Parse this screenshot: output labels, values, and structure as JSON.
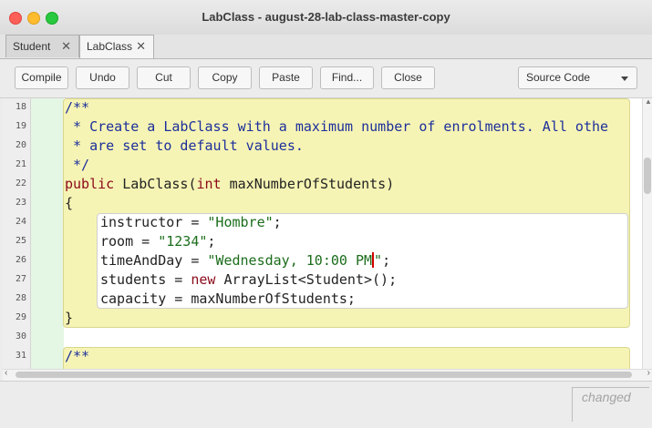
{
  "window": {
    "title": "LabClass - august-28-lab-class-master-copy"
  },
  "tabs": [
    {
      "label": "Student",
      "close": "✕"
    },
    {
      "label": "LabClass",
      "close": "✕"
    }
  ],
  "toolbar": {
    "compile": "Compile",
    "undo": "Undo",
    "cut": "Cut",
    "copy": "Copy",
    "paste": "Paste",
    "find": "Find...",
    "close": "Close",
    "view_select": "Source Code"
  },
  "editor": {
    "line_numbers": [
      "18",
      "19",
      "20",
      "21",
      "22",
      "23",
      "24",
      "25",
      "26",
      "27",
      "28",
      "29",
      "30",
      "31"
    ],
    "lines": {
      "l18": "/**",
      "l19": " * Create a LabClass with a maximum number of enrolments. All othe",
      "l20": " * are set to default values.",
      "l21": " */",
      "l22_kw": "public",
      "l22_a": " LabClass(",
      "l22_kw2": "int",
      "l22_b": " maxNumberOfStudents)",
      "l23": "{",
      "l24_a": "instructor = ",
      "l24_s": "\"Hombre\"",
      "l24_b": ";",
      "l25_a": "room = ",
      "l25_s": "\"1234\"",
      "l25_b": ";",
      "l26_a": "timeAndDay = ",
      "l26_s1": "\"Wednesday, 10:00 PM",
      "l26_s2": "\"",
      "l26_b": ";",
      "l27_a": "students = ",
      "l27_kw": "new",
      "l27_b": " ArrayList<Student>();",
      "l28": "capacity = maxNumberOfStudents;",
      "l29": "}",
      "l31": "/**"
    }
  },
  "status": {
    "changed": "changed"
  }
}
